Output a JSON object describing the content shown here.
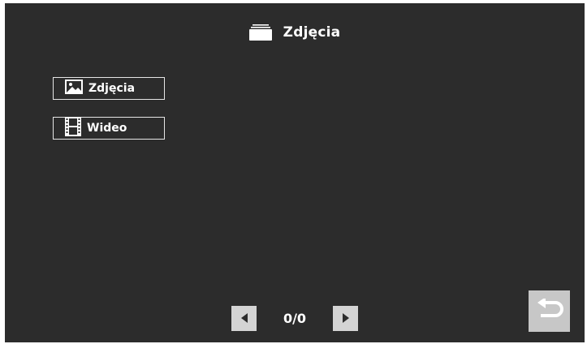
{
  "header": {
    "title": "Zdjęcia",
    "icon": "photo-stack-icon"
  },
  "menu": [
    {
      "label": "Zdjęcia",
      "icon": "image-icon"
    },
    {
      "label": "Wideo",
      "icon": "film-strip-icon"
    }
  ],
  "pager": {
    "text": "0/0",
    "prev_icon": "triangle-left-icon",
    "next_icon": "triangle-right-icon"
  },
  "back": {
    "icon": "return-arrow-icon"
  },
  "colors": {
    "background": "#2c2c2c",
    "text": "#ffffff",
    "button_border": "#e6e6e6",
    "pager_button": "#d4d4d4",
    "back_button": "#c7c7c7"
  }
}
